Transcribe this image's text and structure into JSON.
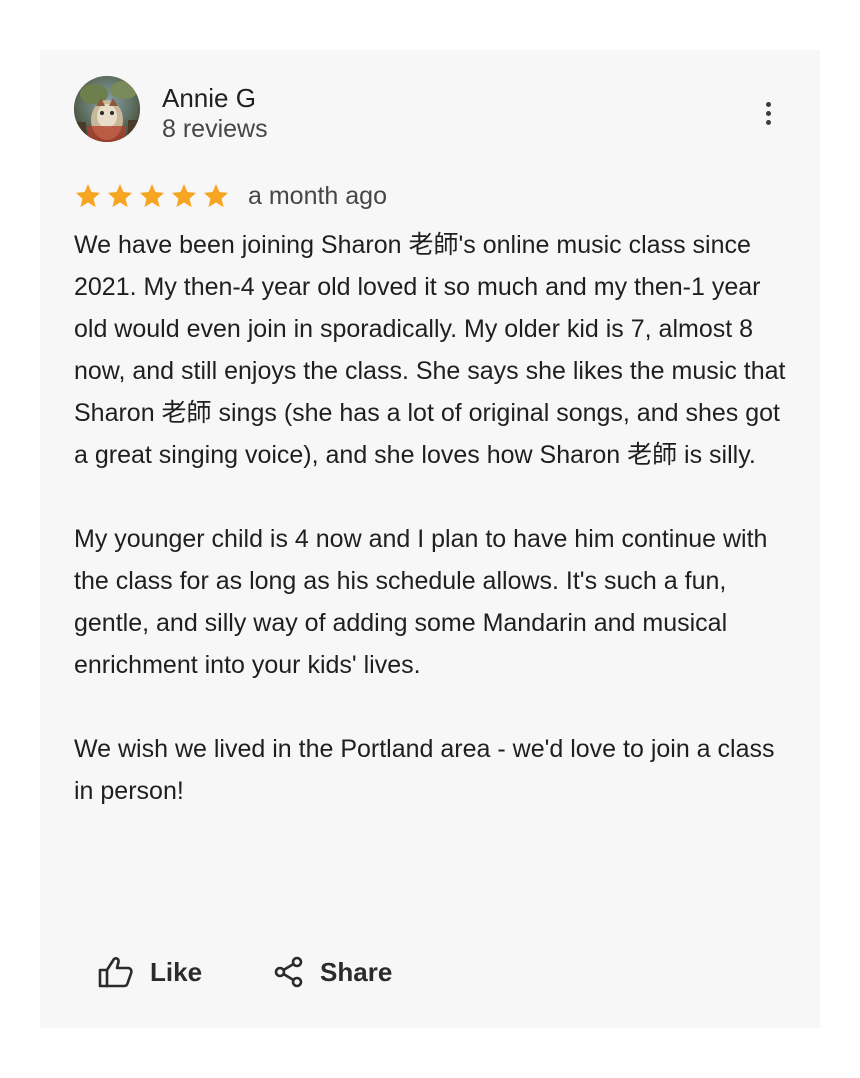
{
  "review": {
    "author": {
      "name": "Annie G",
      "reviews": "8 reviews",
      "avatar_icon": "avatar-photo"
    },
    "rating": 5,
    "rating_max": 5,
    "star_color": "#f5a623",
    "date": "a month ago",
    "paragraphs": [
      "We have been joining Sharon 老師's online music class since 2021. My then-4 year old loved it so much and my then-1 year old would even join in sporadically. My older kid is 7, almost 8 now, and still enjoys the class. She says she likes the music that Sharon 老師 sings (she has a lot of original songs, and shes got a great singing voice), and she loves how Sharon 老師 is silly.",
      "My younger child is 4 now and I plan to have him continue with the class for as long as his schedule allows. It's such a fun, gentle, and silly way of adding some Mandarin and musical enrichment into your kids' lives.",
      "We wish we lived in the Portland area - we'd love to join a class in person!"
    ]
  },
  "actions": {
    "like_label": "Like",
    "like_icon": "thumbs-up-icon",
    "share_label": "Share",
    "share_icon": "share-icon",
    "more_icon": "more-vertical-icon"
  }
}
